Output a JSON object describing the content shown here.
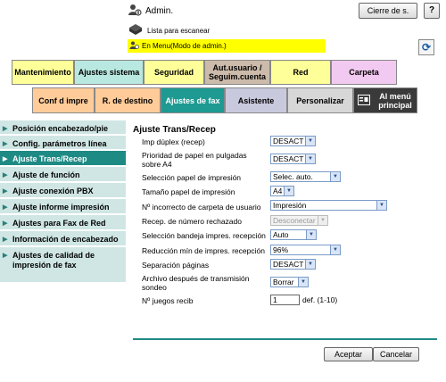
{
  "header": {
    "user": "Admin.",
    "logout": "Cierre de s.",
    "help": "?",
    "scan_list": "Lista para escanear",
    "mode_banner": "En Menu(Modo de admin.)"
  },
  "tabs_top": [
    {
      "label": "Mantenimiento",
      "color": "#ffff99"
    },
    {
      "label": "Ajustes sistema",
      "color": "#b8e8e0"
    },
    {
      "label": "Seguridad",
      "color": "#ffff99"
    },
    {
      "label": "Aut.usuario / Seguim.cuenta",
      "color": "#ccbbaa"
    },
    {
      "label": "Red",
      "color": "#ffff99"
    },
    {
      "label": "Carpeta",
      "color": "#f2c9f0"
    }
  ],
  "tabs_bottom": [
    {
      "label": "Conf d impre",
      "color": "#ffcc99"
    },
    {
      "label": "R. de destino",
      "color": "#ffcc99"
    },
    {
      "label": "Ajustes de fax",
      "color": "#1e9a92",
      "active": true
    },
    {
      "label": "Asistente",
      "color": "#c9c9de"
    },
    {
      "label": "Personalizar",
      "color": "#d7d7d7"
    },
    {
      "label": "Al menú principal",
      "color": "#3a3a3a"
    }
  ],
  "sidebar": {
    "items": [
      {
        "label": "Posición encabezado/pie"
      },
      {
        "label": "Config. parámetros línea"
      },
      {
        "label": "Ajuste Trans/Recep",
        "active": true
      },
      {
        "label": "Ajuste de función"
      },
      {
        "label": "Ajuste conexión PBX"
      },
      {
        "label": "Ajuste informe impresión"
      },
      {
        "label": "Ajustes para Fax de Red"
      },
      {
        "label": "Información de encabezado"
      },
      {
        "label": "Ajustes de calidad de impresión de fax"
      }
    ]
  },
  "main": {
    "title": "Ajuste Trans/Recep",
    "fields": [
      {
        "label": "Imp dúplex (recep)",
        "value": "DESACT"
      },
      {
        "label": "Prioridad de papel en pulgadas sobre A4",
        "value": "DESACT"
      },
      {
        "label": "Selección papel de impresión",
        "value": "Selec. auto."
      },
      {
        "label": "Tamaño papel de impresión",
        "value": "A4"
      },
      {
        "label": "Nº incorrecto de carpeta de usuario",
        "value": "Impresión"
      },
      {
        "label": "Recep. de número rechazado",
        "value": "Desconectar",
        "disabled": true
      },
      {
        "label": "Selección bandeja impres. recepción",
        "value": "Auto"
      },
      {
        "label": "Reducción mín de impres. recepción",
        "value": "96%"
      },
      {
        "label": "Separación páginas",
        "value": "DESACT"
      },
      {
        "label": "Archivo después de transmisión sondeo",
        "value": "Borrar"
      },
      {
        "label": "Nº juegos recib",
        "value": "1",
        "suffix": "def. (1-10)"
      }
    ],
    "ok": "Aceptar",
    "cancel": "Cancelar"
  }
}
